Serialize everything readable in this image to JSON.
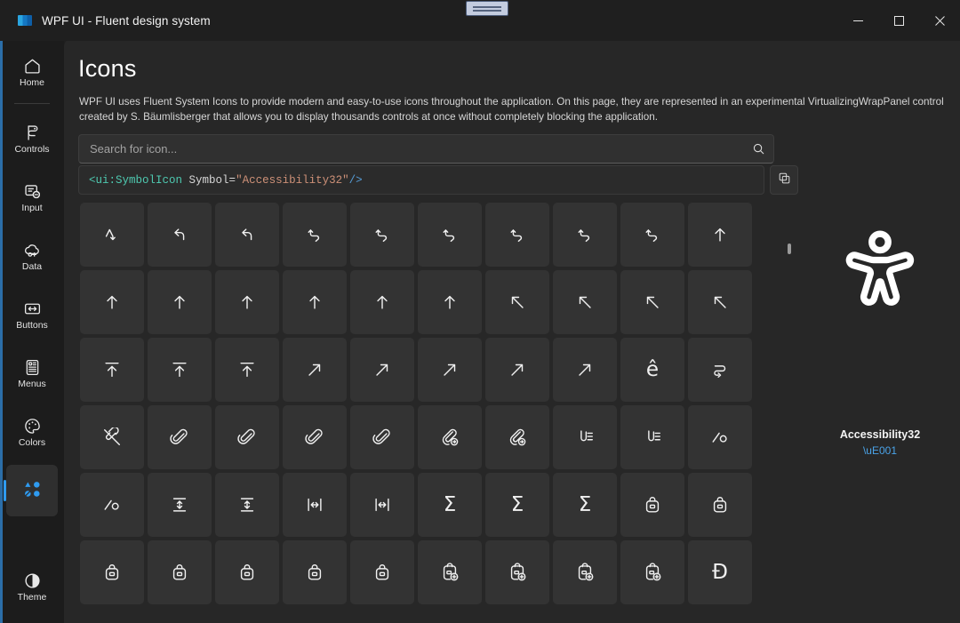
{
  "window": {
    "title": "WPF UI - Fluent design system",
    "logo_icon": "app-logo-icon",
    "minimize_label": "Minimize",
    "maximize_label": "Maximize",
    "close_label": "Close",
    "snap_widget_name": "window-snap-layout-widget"
  },
  "sidebar": {
    "items": [
      {
        "label": "Home",
        "icon": "home-icon"
      },
      {
        "label": "Controls",
        "icon": "controls-icon"
      },
      {
        "label": "Input",
        "icon": "input-icon"
      },
      {
        "label": "Data",
        "icon": "data-icon"
      },
      {
        "label": "Buttons",
        "icon": "buttons-icon"
      },
      {
        "label": "Menus",
        "icon": "menus-icon"
      },
      {
        "label": "Colors",
        "icon": "colors-icon"
      },
      {
        "label": "",
        "icon": "icons-shapes-icon",
        "selected": true
      }
    ],
    "bottom": {
      "label": "Theme",
      "icon": "theme-contrast-icon"
    },
    "accent_color": "#2f9bf0"
  },
  "page": {
    "title": "Icons",
    "description": "WPF UI uses Fluent System Icons to provide modern and easy-to-use icons throughout the application. On this page, they are represented in an experimental VirtualizingWrapPanel control created by S. Bäumlisberger that allows you to display thousands controls at once without completely blocking the application."
  },
  "search": {
    "placeholder": "Search for icon...",
    "value": "",
    "icon": "search-icon"
  },
  "code": {
    "tag_open": "<ui:SymbolIcon",
    "attribute": "Symbol=",
    "value": "\"Accessibility32\"",
    "tag_close": "/>",
    "copy_icon": "copy-icon",
    "colors": {
      "tag": "#4ec9b0",
      "attribute": "#d6d6d6",
      "string": "#ce9178",
      "close": "#569cd6"
    }
  },
  "preview": {
    "icon": "accessibility-person-icon",
    "name": "Accessibility32",
    "unicode": "\\uE001",
    "unicode_color": "#4aa3e8"
  },
  "grid": {
    "columns": 10,
    "rows": 6,
    "tile_color": "#333333",
    "tiles": [
      {
        "icon": "arrow-bounce-icon",
        "glyph": ""
      },
      {
        "icon": "arrow-reply-icon",
        "glyph": ""
      },
      {
        "icon": "arrow-reply-icon",
        "glyph": ""
      },
      {
        "icon": "arrow-undo-icon",
        "glyph": ""
      },
      {
        "icon": "arrow-undo-icon",
        "glyph": ""
      },
      {
        "icon": "arrow-undo-icon",
        "glyph": ""
      },
      {
        "icon": "arrow-undo-icon",
        "glyph": ""
      },
      {
        "icon": "arrow-undo-icon",
        "glyph": ""
      },
      {
        "icon": "arrow-undo-icon",
        "glyph": ""
      },
      {
        "icon": "arrow-up-icon",
        "glyph": ""
      },
      {
        "icon": "arrow-up-icon",
        "glyph": ""
      },
      {
        "icon": "arrow-up-icon",
        "glyph": ""
      },
      {
        "icon": "arrow-up-icon",
        "glyph": ""
      },
      {
        "icon": "arrow-up-icon",
        "glyph": ""
      },
      {
        "icon": "arrow-up-icon",
        "glyph": ""
      },
      {
        "icon": "arrow-up-icon",
        "glyph": ""
      },
      {
        "icon": "arrow-up-left-icon",
        "glyph": ""
      },
      {
        "icon": "arrow-up-left-icon",
        "glyph": ""
      },
      {
        "icon": "arrow-up-left-icon",
        "glyph": ""
      },
      {
        "icon": "arrow-up-left-icon",
        "glyph": ""
      },
      {
        "icon": "arrow-upload-icon",
        "glyph": ""
      },
      {
        "icon": "arrow-upload-icon",
        "glyph": ""
      },
      {
        "icon": "arrow-upload-icon",
        "glyph": ""
      },
      {
        "icon": "arrow-up-right-icon",
        "glyph": ""
      },
      {
        "icon": "arrow-up-right-icon",
        "glyph": ""
      },
      {
        "icon": "arrow-up-right-icon",
        "glyph": ""
      },
      {
        "icon": "arrow-up-right-icon",
        "glyph": ""
      },
      {
        "icon": "arrow-up-right-icon",
        "glyph": ""
      },
      {
        "icon": "letter-e-circumflex-glyph",
        "glyph": "ê"
      },
      {
        "icon": "arrow-wrap-icon",
        "glyph": ""
      },
      {
        "icon": "attach-off-icon",
        "glyph": ""
      },
      {
        "icon": "attach-icon",
        "glyph": ""
      },
      {
        "icon": "attach-icon",
        "glyph": ""
      },
      {
        "icon": "attach-icon",
        "glyph": ""
      },
      {
        "icon": "attach-icon",
        "glyph": ""
      },
      {
        "icon": "attach-arrow-right-icon",
        "glyph": ""
      },
      {
        "icon": "attach-arrow-right-icon",
        "glyph": ""
      },
      {
        "icon": "attach-text-icon",
        "glyph": ""
      },
      {
        "icon": "attach-text-icon",
        "glyph": ""
      },
      {
        "icon": "autocorrect-icon",
        "glyph": ""
      },
      {
        "icon": "autocorrect-icon",
        "glyph": ""
      },
      {
        "icon": "autofit-height-icon",
        "glyph": ""
      },
      {
        "icon": "autofit-height-icon",
        "glyph": ""
      },
      {
        "icon": "autofit-width-icon",
        "glyph": ""
      },
      {
        "icon": "autofit-width-icon",
        "glyph": ""
      },
      {
        "icon": "autosum-icon",
        "glyph": "Σ"
      },
      {
        "icon": "autosum-icon",
        "glyph": "Σ"
      },
      {
        "icon": "autosum-icon",
        "glyph": "Σ"
      },
      {
        "icon": "backpack-icon",
        "glyph": ""
      },
      {
        "icon": "backpack-icon",
        "glyph": ""
      },
      {
        "icon": "backpack-icon",
        "glyph": ""
      },
      {
        "icon": "backpack-icon",
        "glyph": ""
      },
      {
        "icon": "backpack-icon",
        "glyph": ""
      },
      {
        "icon": "backpack-icon",
        "glyph": ""
      },
      {
        "icon": "backpack-icon",
        "glyph": ""
      },
      {
        "icon": "backpack-add-icon",
        "glyph": ""
      },
      {
        "icon": "backpack-add-icon",
        "glyph": ""
      },
      {
        "icon": "backpack-add-icon",
        "glyph": ""
      },
      {
        "icon": "backpack-add-icon",
        "glyph": ""
      },
      {
        "icon": "letter-d-stroke-glyph",
        "glyph": "Đ"
      }
    ]
  }
}
